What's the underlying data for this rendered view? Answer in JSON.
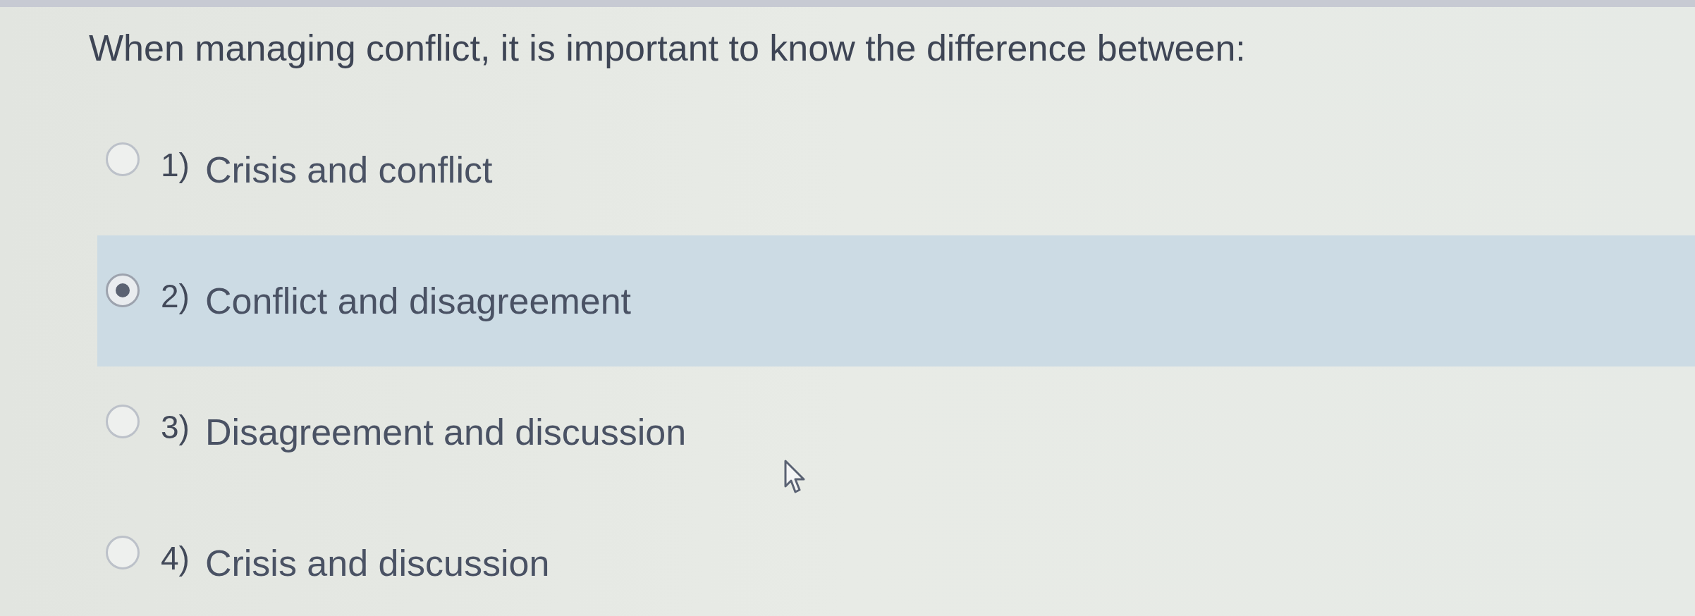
{
  "question": {
    "text": "When managing conflict, it is important to know the difference between:"
  },
  "options": [
    {
      "number": "1)",
      "label": "Crisis and conflict",
      "selected": false
    },
    {
      "number": "2)",
      "label": "Conflict and disagreement",
      "selected": true
    },
    {
      "number": "3)",
      "label": "Disagreement and discussion",
      "selected": false
    },
    {
      "number": "4)",
      "label": "Crisis and discussion",
      "selected": false
    }
  ]
}
